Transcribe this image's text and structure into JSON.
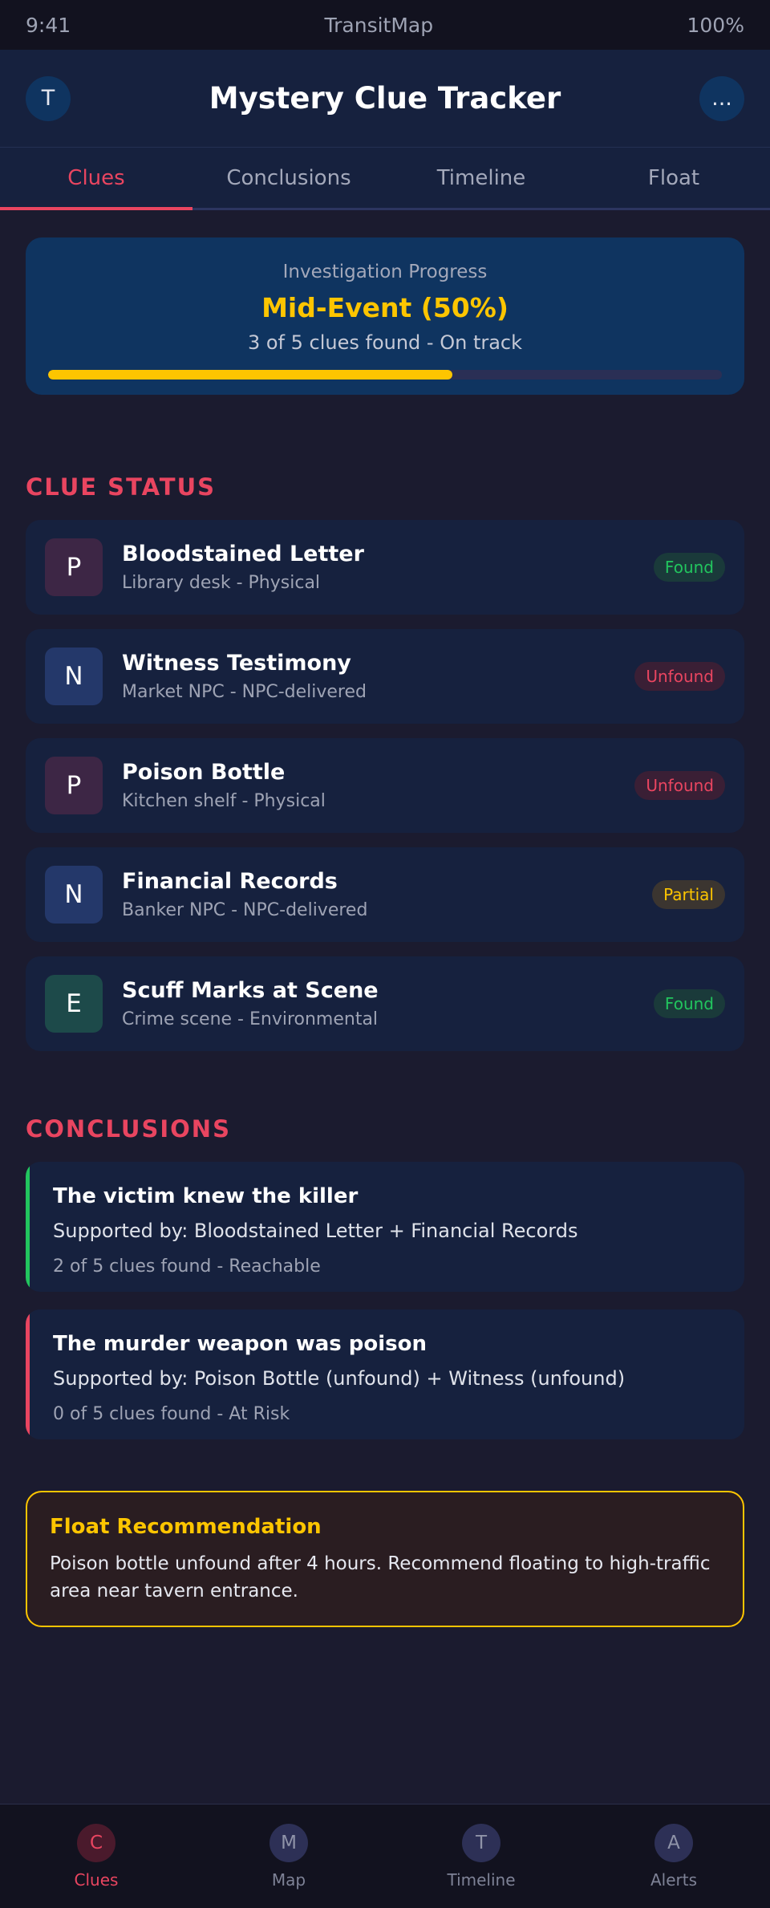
{
  "status_bar": {
    "time": "9:41",
    "app": "TransitMap",
    "battery": "100%"
  },
  "header": {
    "avatar_letter": "T",
    "title": "Mystery Clue Tracker",
    "menu_label": "..."
  },
  "tabs": [
    {
      "label": "Clues"
    },
    {
      "label": "Conclusions"
    },
    {
      "label": "Timeline"
    },
    {
      "label": "Float"
    }
  ],
  "progress": {
    "label": "Investigation Progress",
    "value": "Mid-Event (50%)",
    "subtitle": "3 of 5 clues found - On track",
    "fill_fraction": 0.6
  },
  "clue_section": {
    "title": "CLUE STATUS",
    "items": [
      {
        "letter": "P",
        "name": "Bloodstained Letter",
        "meta": "Library desk - Physical",
        "status": "Found"
      },
      {
        "letter": "N",
        "name": "Witness Testimony",
        "meta": "Market NPC - NPC-delivered",
        "status": "Unfound"
      },
      {
        "letter": "P",
        "name": "Poison Bottle",
        "meta": "Kitchen shelf - Physical",
        "status": "Unfound"
      },
      {
        "letter": "N",
        "name": "Financial Records",
        "meta": "Banker NPC - NPC-delivered",
        "status": "Partial"
      },
      {
        "letter": "E",
        "name": "Scuff Marks at Scene",
        "meta": "Crime scene - Environmental",
        "status": "Found"
      }
    ]
  },
  "conclusion_section": {
    "title": "CONCLUSIONS",
    "items": [
      {
        "title": "The victim knew the killer",
        "support": "Supported by: Bloodstained Letter + Financial Records",
        "status": "2 of 5 clues found - Reachable"
      },
      {
        "title": "The murder weapon was poison",
        "support": "Supported by: Poison Bottle (unfound) + Witness (unfound)",
        "status": "0 of 5 clues found - At Risk"
      }
    ]
  },
  "float": {
    "title": "Float Recommendation",
    "body": "Poison bottle unfound after 4 hours. Recommend floating to high-traffic area near tavern entrance."
  },
  "bottom_nav": [
    {
      "letter": "C",
      "label": "Clues"
    },
    {
      "letter": "M",
      "label": "Map"
    },
    {
      "letter": "T",
      "label": "Timeline"
    },
    {
      "letter": "A",
      "label": "Alerts"
    }
  ],
  "colors": {
    "accent": "#e94560",
    "highlight": "#fdc500",
    "found": "#22c55e",
    "unfound": "#e94560",
    "partial": "#fdc500",
    "type_physical": "#3d2645",
    "type_npc": "#24386a",
    "type_environmental": "#1d4a4a"
  }
}
